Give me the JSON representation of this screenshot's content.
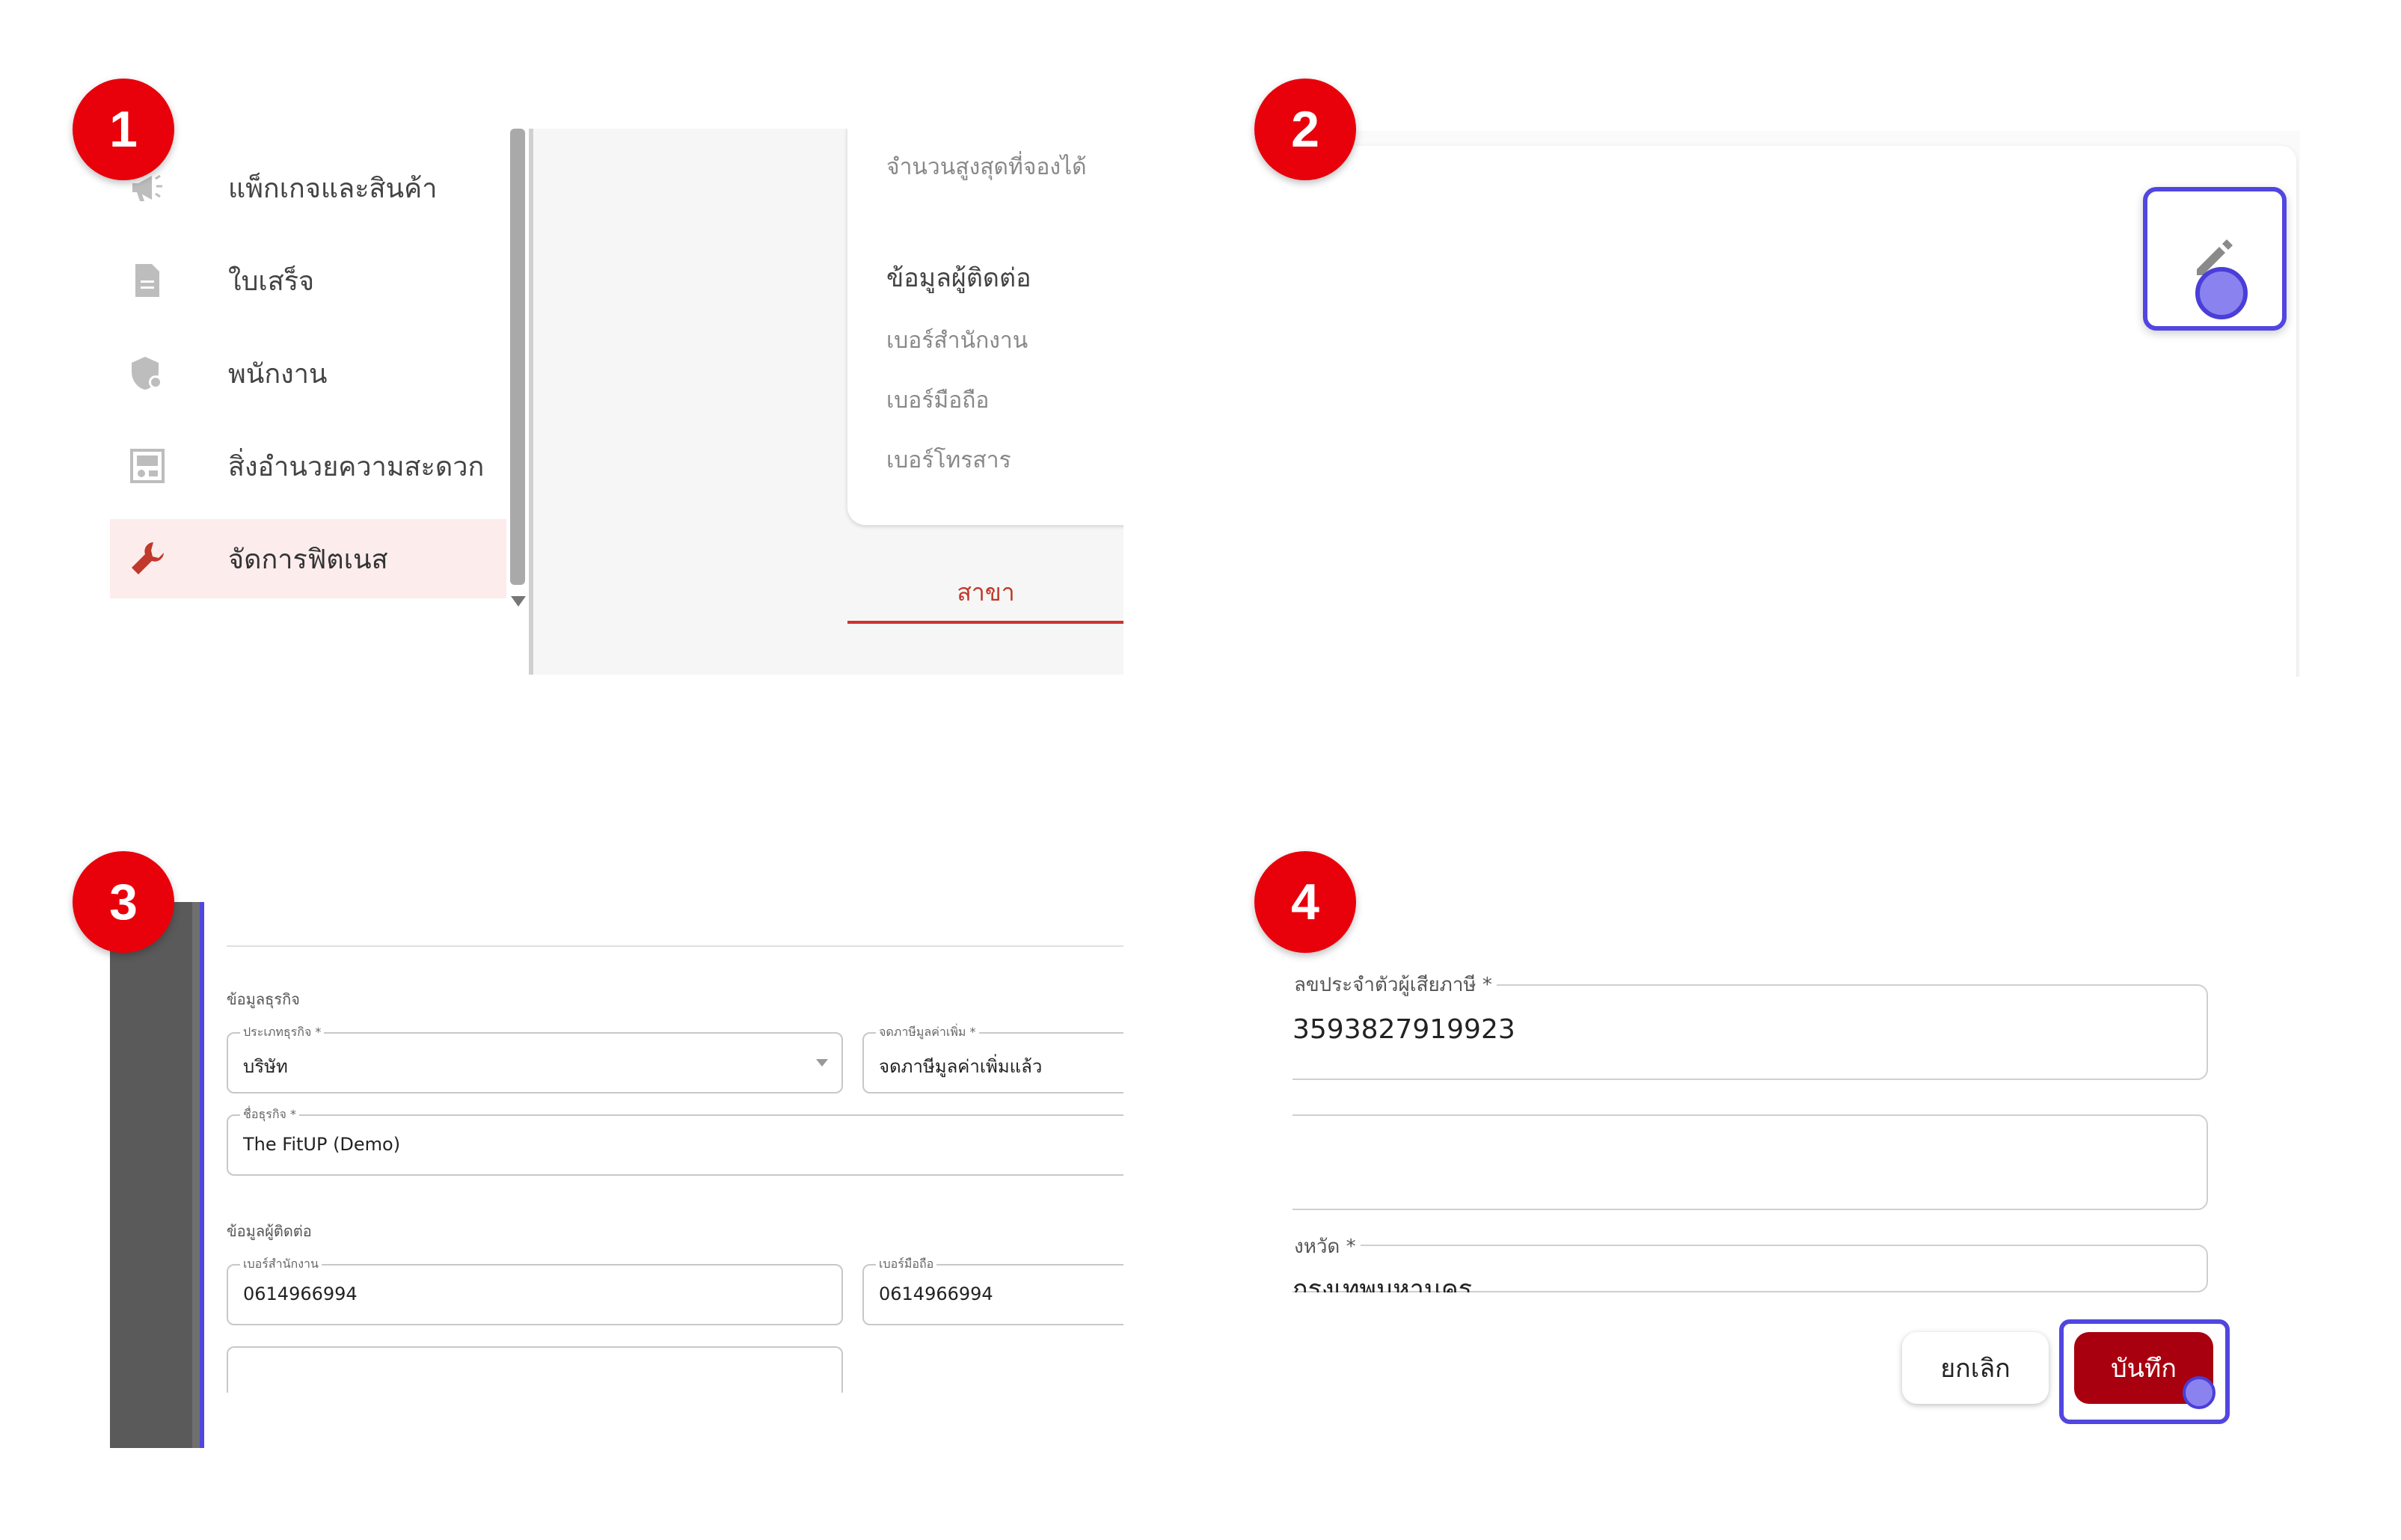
{
  "steps": [
    "1",
    "2",
    "3",
    "4"
  ],
  "panel1": {
    "menu": [
      {
        "label": "แพ็กเกจและสินค้า",
        "icon": "megaphone-icon"
      },
      {
        "label": "ใบเสร็จ",
        "icon": "receipt-icon"
      },
      {
        "label": "พนักงาน",
        "icon": "staff-shield-icon"
      },
      {
        "label": "สิ่งอำนวยความสะดวก",
        "icon": "facility-icon"
      },
      {
        "label": "จัดการฟิตเนส",
        "icon": "wrench-icon",
        "active": true
      }
    ],
    "card": {
      "max_booking": "จำนวนสูงสุดที่จองได้",
      "contact_heading": "ข้อมูลผู้ติดต่อ",
      "office_phone": "เบอร์สำนักงาน",
      "mobile_phone": "เบอร์มือถือ",
      "fax": "เบอร์โทรสาร"
    },
    "tab_branch": "สาขา"
  },
  "panel2": {
    "edit_button_icon": "pencil-icon"
  },
  "panel3": {
    "business_section": "ข้อมูลธุรกิจ",
    "business_type": {
      "label": "ประเภทธุรกิจ *",
      "value": "บริษัท"
    },
    "vat": {
      "label": "จดภาษีมูลค่าเพิ่ม *",
      "value": "จดภาษีมูลค่าเพิ่มแล้ว"
    },
    "business_name": {
      "label": "ชื่อธุรกิจ *",
      "value": "The FitUP (Demo)"
    },
    "contact_section": "ข้อมูลผู้ติดต่อ",
    "office_phone": {
      "label": "เบอร์สำนักงาน",
      "value": "0614966994"
    },
    "mobile_phone": {
      "label": "เบอร์มือถือ",
      "value": "0614966994"
    }
  },
  "panel4": {
    "tax_id": {
      "label": "ลขประจำตัวผู้เสียภาษี *",
      "value": "3593827919923"
    },
    "province": {
      "label": "งหวัด *",
      "value": "กรุงเทพมหานคร"
    },
    "cancel_label": "ยกเลิก",
    "save_label": "บันทึก"
  },
  "colors": {
    "badge": "#e8000b",
    "highlight": "#5146e0",
    "save_button": "#a8000f",
    "tab_accent": "#d0312d"
  }
}
